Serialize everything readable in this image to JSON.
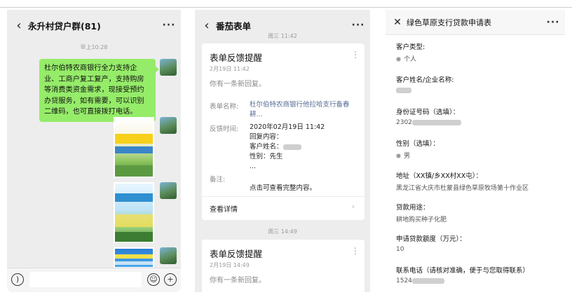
{
  "chat": {
    "title": "永升村贷户群(81)",
    "time": "早上10:28",
    "message": "杜尔伯特农商银行全力支持企业、工商户复工复产，支持购房等消费类资金需求，现接受预约办贷服务，如有需要，可以识别二维码，也可直接拨打电话。"
  },
  "forms": {
    "title": "番茄表单",
    "time1": "周三 11:42",
    "time2": "周三 14:49",
    "card1": {
      "title": "表单反馈提醒",
      "date": "2月19日 11:42",
      "desc": "你有一条新回复。",
      "name_label": "表单名称:",
      "name_value": "杜尔伯特农商银行他拉哈支行备春耕...",
      "time_label": "反馈时间:",
      "time_value": "2020年02月19日 11:42",
      "content_line1": "回复内容：",
      "content_line2": "客户姓名：",
      "content_line3": "性别：先生",
      "content_line4": "...",
      "note_label": "备注:",
      "note_value": "点击可查看完整内容。",
      "detail": "查看详情"
    },
    "card2": {
      "title": "表单反馈提醒",
      "date": "2月19日 14:49",
      "desc": "你有一条新回复。"
    }
  },
  "application": {
    "title": "绿色草原支行贷款申请表",
    "fields": [
      {
        "label": "客户类型:",
        "value": "个人"
      },
      {
        "label": "客户姓名/企业名称:",
        "value": ""
      },
      {
        "label": "身份证号码（选填）：",
        "value": "2302"
      },
      {
        "label": "性别（选填）：",
        "value": "男"
      },
      {
        "label": "地址（XX镇/乡XX村XX屯）：",
        "value": "黑龙江省大庆市杜蒙县绿色草原牧场第十作业区"
      },
      {
        "label": "贷款用途：",
        "value": "耕地购买种子化肥"
      },
      {
        "label": "申请贷款额度（万元）：",
        "value": "10"
      },
      {
        "label": "联系电话（请核对准确，便于与您取得联系）",
        "value": "1524"
      }
    ]
  },
  "colors": {
    "bubble": "#95ec69",
    "chat_bg": "#ededed",
    "link": "#576b95"
  }
}
